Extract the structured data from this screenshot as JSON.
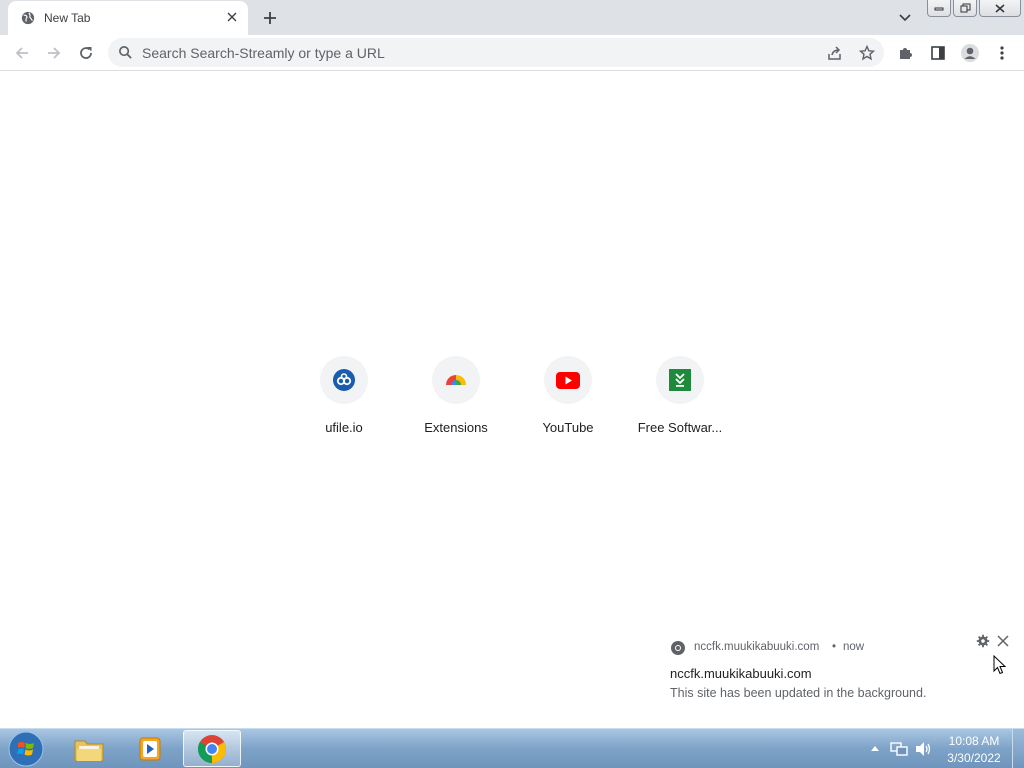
{
  "browser": {
    "tab": {
      "title": "New Tab",
      "favicon": "globe-icon",
      "close_icon": "close-icon"
    },
    "new_tab_icon": "plus-icon",
    "tab_search_icon": "chevron-down-icon",
    "window_controls": [
      "minimize-icon",
      "restore-icon",
      "close-icon"
    ],
    "toolbar": {
      "back_icon": "arrow-left-icon",
      "forward_icon": "arrow-right-icon",
      "reload_icon": "reload-icon",
      "omnibox_placeholder": "Search Search-Streamly or type a URL",
      "share_icon": "share-icon",
      "bookmark_icon": "star-icon",
      "extensions_icon": "puzzle-icon",
      "side_panel_icon": "side-panel-icon",
      "profile_icon": "person-icon",
      "menu_icon": "kebab-menu-icon"
    }
  },
  "ntp": {
    "shortcuts": [
      {
        "label": "ufile.io",
        "icon": "ufile-icon"
      },
      {
        "label": "Extensions",
        "icon": "chrome-extensions-icon"
      },
      {
        "label": "YouTube",
        "icon": "youtube-icon"
      },
      {
        "label": "Free Softwar...",
        "icon": "download-arrow-icon"
      }
    ]
  },
  "notification": {
    "origin": "nccfk.muukikabuuki.com",
    "separator": "•",
    "time": "now",
    "title": "nccfk.muukikabuuki.com",
    "body": "This site has been updated in the background."
  },
  "taskbar": {
    "apps": [
      "explorer-icon",
      "media-player-icon",
      "chrome-icon"
    ],
    "clock": {
      "time": "10:08 AM",
      "date": "3/30/2022"
    }
  },
  "colors": {
    "tabstrip": "#dee1e6",
    "omnibox": "#f1f3f4",
    "youtube_red": "#ff0000",
    "ufile_blue": "#1a5db0",
    "freesoft_green": "#1e8a3c",
    "taskbar": "#7ea3c8"
  }
}
